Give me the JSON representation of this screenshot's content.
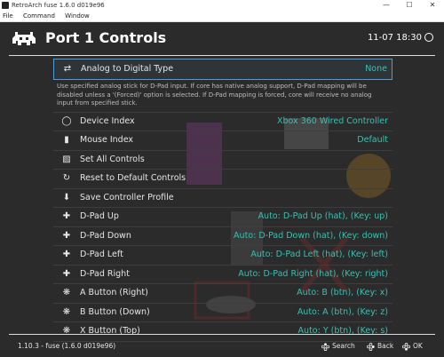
{
  "window": {
    "title": "RetroArch fuse 1.6.0 d019e96",
    "menu": [
      "File",
      "Command",
      "Window"
    ]
  },
  "header": {
    "title": "Port 1 Controls",
    "time": "11-07 18:30"
  },
  "selected": {
    "label": "Analog to Digital Type",
    "value": "None",
    "icon": "dpad-analog-icon",
    "description": "Use specified analog stick for D-Pad input. If core has native analog support, D-Pad mapping will be disabled unless a '(Forced)' option is selected. If D-Pad mapping is forced, core will receive no analog input from specified stick."
  },
  "items": [
    {
      "label": "Device Index",
      "value": "Xbox 360 Wired Controller",
      "icon": "gamepad-icon"
    },
    {
      "label": "Mouse Index",
      "value": "Default",
      "icon": "mouse-icon"
    },
    {
      "label": "Set All Controls",
      "value": "",
      "icon": "keyboard-icon"
    },
    {
      "label": "Reset to Default Controls",
      "value": "",
      "icon": "reset-icon"
    },
    {
      "label": "Save Controller Profile",
      "value": "",
      "icon": "save-icon"
    },
    {
      "label": "D-Pad Up",
      "value": "Auto:  D-Pad Up (hat), (Key: up)",
      "icon": "dpad-up-icon"
    },
    {
      "label": "D-Pad Down",
      "value": "Auto:  D-Pad Down (hat), (Key: down)",
      "icon": "dpad-down-icon"
    },
    {
      "label": "D-Pad Left",
      "value": "Auto:  D-Pad Left (hat), (Key: left)",
      "icon": "dpad-left-icon"
    },
    {
      "label": "D-Pad Right",
      "value": "Auto:  D-Pad Right (hat), (Key: right)",
      "icon": "dpad-right-icon"
    },
    {
      "label": "A Button (Right)",
      "value": "Auto:  B (btn), (Key: x)",
      "icon": "button-right-icon"
    },
    {
      "label": "B Button (Down)",
      "value": "Auto:  A (btn), (Key: z)",
      "icon": "button-down-icon"
    },
    {
      "label": "X Button (Top)",
      "value": "Auto:  Y (btn), (Key: s)",
      "icon": "button-top-icon"
    }
  ],
  "footer": {
    "version": "1.10.3 - fuse (1.6.0 d019e96)",
    "search": "Search",
    "back": "Back",
    "ok": "OK"
  },
  "colors": {
    "accent": "#33c3b5",
    "selection_border": "#4a9fd8",
    "background": "#2b2b2b"
  }
}
